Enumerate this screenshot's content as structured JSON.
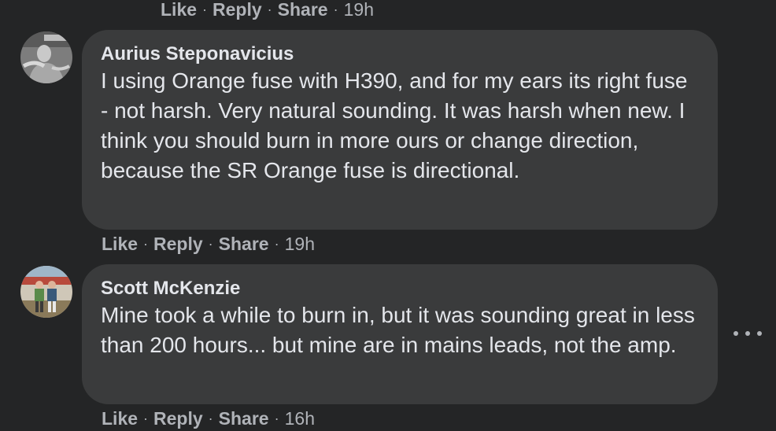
{
  "top_actions": {
    "like": "Like",
    "reply": "Reply",
    "share": "Share",
    "sep": "·",
    "time": "19h"
  },
  "comments": [
    {
      "author": "Aurius Steponavicius",
      "text": "I using Orange fuse with H390, and for my ears its right fuse - not harsh. Very natural sounding. It was harsh when new. I think you should burn in more ours or change direction, because the SR Orange fuse is directional.",
      "actions": {
        "like": "Like",
        "reply": "Reply",
        "share": "Share",
        "sep": "·",
        "time": "19h"
      }
    },
    {
      "author": "Scott McKenzie",
      "text": "Mine took a while to burn in, but it was sounding great in less than 200 hours... but mine are in mains leads, not the amp.",
      "actions": {
        "like": "Like",
        "reply": "Reply",
        "share": "Share",
        "sep": "·",
        "time": "16h"
      }
    }
  ],
  "icons": {
    "more": "more-horizontal-icon"
  },
  "colors": {
    "background": "#242526",
    "bubble": "#3a3b3c",
    "text": "#e4e6eb",
    "muted": "#b0b3b8"
  }
}
